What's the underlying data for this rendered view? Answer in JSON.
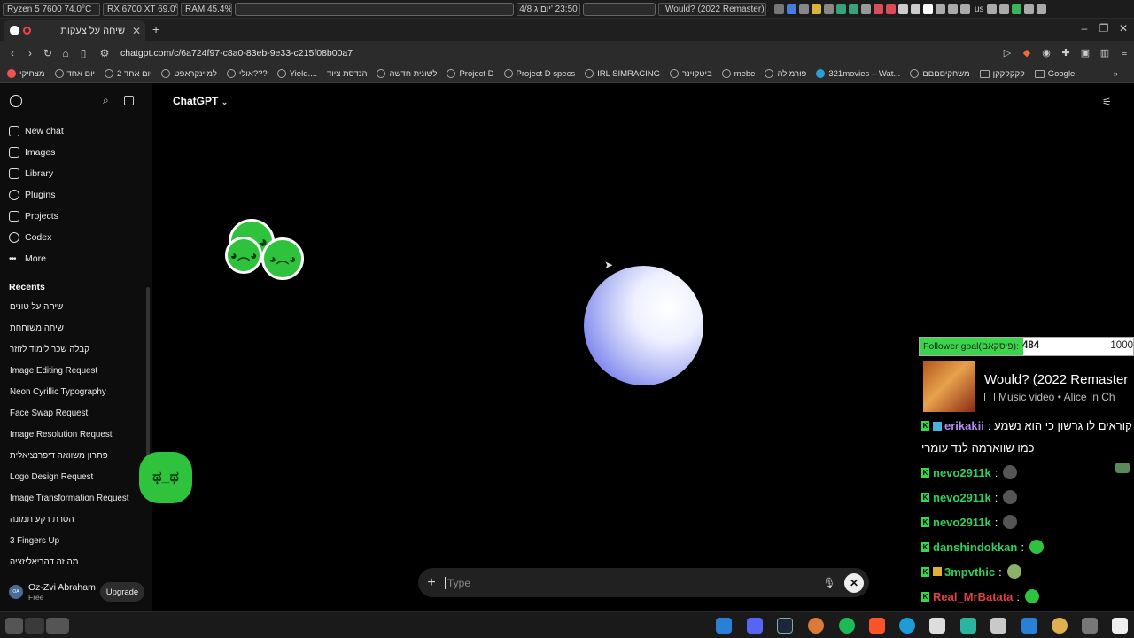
{
  "system": {
    "cpu": "Ryzen 5 7600  74.0°C",
    "gpu": "RX 6700 XT 69.0°C",
    "ram": "RAM   45.4%",
    "date": "4/8 יום ג'",
    "time": "23:50",
    "now_playing": "Would? (2022 Remaster)",
    "keyboard": "us"
  },
  "browser": {
    "tab_title": "שיחה על צעקות",
    "url": "chatgpt.com/c/6a724f97-c8a0-83eb-9e33-c215f08b00a7",
    "new_tab": "+",
    "bookmarks": [
      "מצחיקי",
      "יום אחד",
      "יום אחד 2",
      "למיינקראפט",
      "אולי???",
      "Yield....",
      "הנדסת ציוד",
      "לשונית חדשה",
      "Project D",
      "Project D specs",
      "IRL SIMRACING",
      "ביטקוינר",
      "mebe",
      "פורמולה",
      "321movies – Wat...",
      "משחקיםםםם",
      "קקקקקקן",
      "Google"
    ]
  },
  "sidebar": {
    "nav": [
      "New chat",
      "Images",
      "Library",
      "Plugins",
      "Projects",
      "Codex",
      "More"
    ],
    "recents_title": "Recents",
    "recents": [
      "שיחה על טונים",
      "שיחה משוחחת",
      "קבלה שכר לימוד לזוזר",
      "Image Editing Request",
      "Neon Cyrillic Typography",
      "Face Swap Request",
      "Image Resolution Request",
      "פתרון משוואה דיפרנציאלית",
      "Logo Design Request",
      "Image Transformation Request",
      "הסרת רקע תמונה",
      "3 Fingers Up",
      "מה זה דהריאליזציה"
    ],
    "user_name": "Oz-Zvi Abraham",
    "user_plan": "Free",
    "avatar_initials": "OA",
    "upgrade": "Upgrade"
  },
  "main": {
    "model": "ChatGPT",
    "input_placeholder": "Type"
  },
  "overlay": {
    "goal_label": "Follower goal(פיסקאם):",
    "goal_current": "484",
    "goal_target": "1000",
    "goal_progress": 0.484,
    "song_title": "Would? (2022 Remaster",
    "song_sub": "Music video • Alice In Ch",
    "chat": [
      {
        "user": "erikakii",
        "text": ": קוראים לו גרשון כי הוא נשמע",
        "color": "#2ed05a"
      },
      {
        "user": "",
        "text": "כמו שווארמה לנד עומרי",
        "color": "#ffffff"
      },
      {
        "user": "nevo2911k",
        "text": ":",
        "color": "#2ed05a"
      },
      {
        "user": "nevo2911k",
        "text": ":",
        "color": "#2ed05a"
      },
      {
        "user": "nevo2911k",
        "text": ":",
        "color": "#2ed05a"
      },
      {
        "user": "danshindokkan",
        "text": ":",
        "color": "#2ed05a"
      },
      {
        "user": "3mpvthic",
        "text": ":",
        "color": "#2ed05a"
      },
      {
        "user": "Real_MrBatata",
        "text": ":",
        "color": "#e0404a"
      }
    ]
  },
  "colors": {
    "accent_green": "#39d64b",
    "orb_blue": "#6a74e6"
  }
}
